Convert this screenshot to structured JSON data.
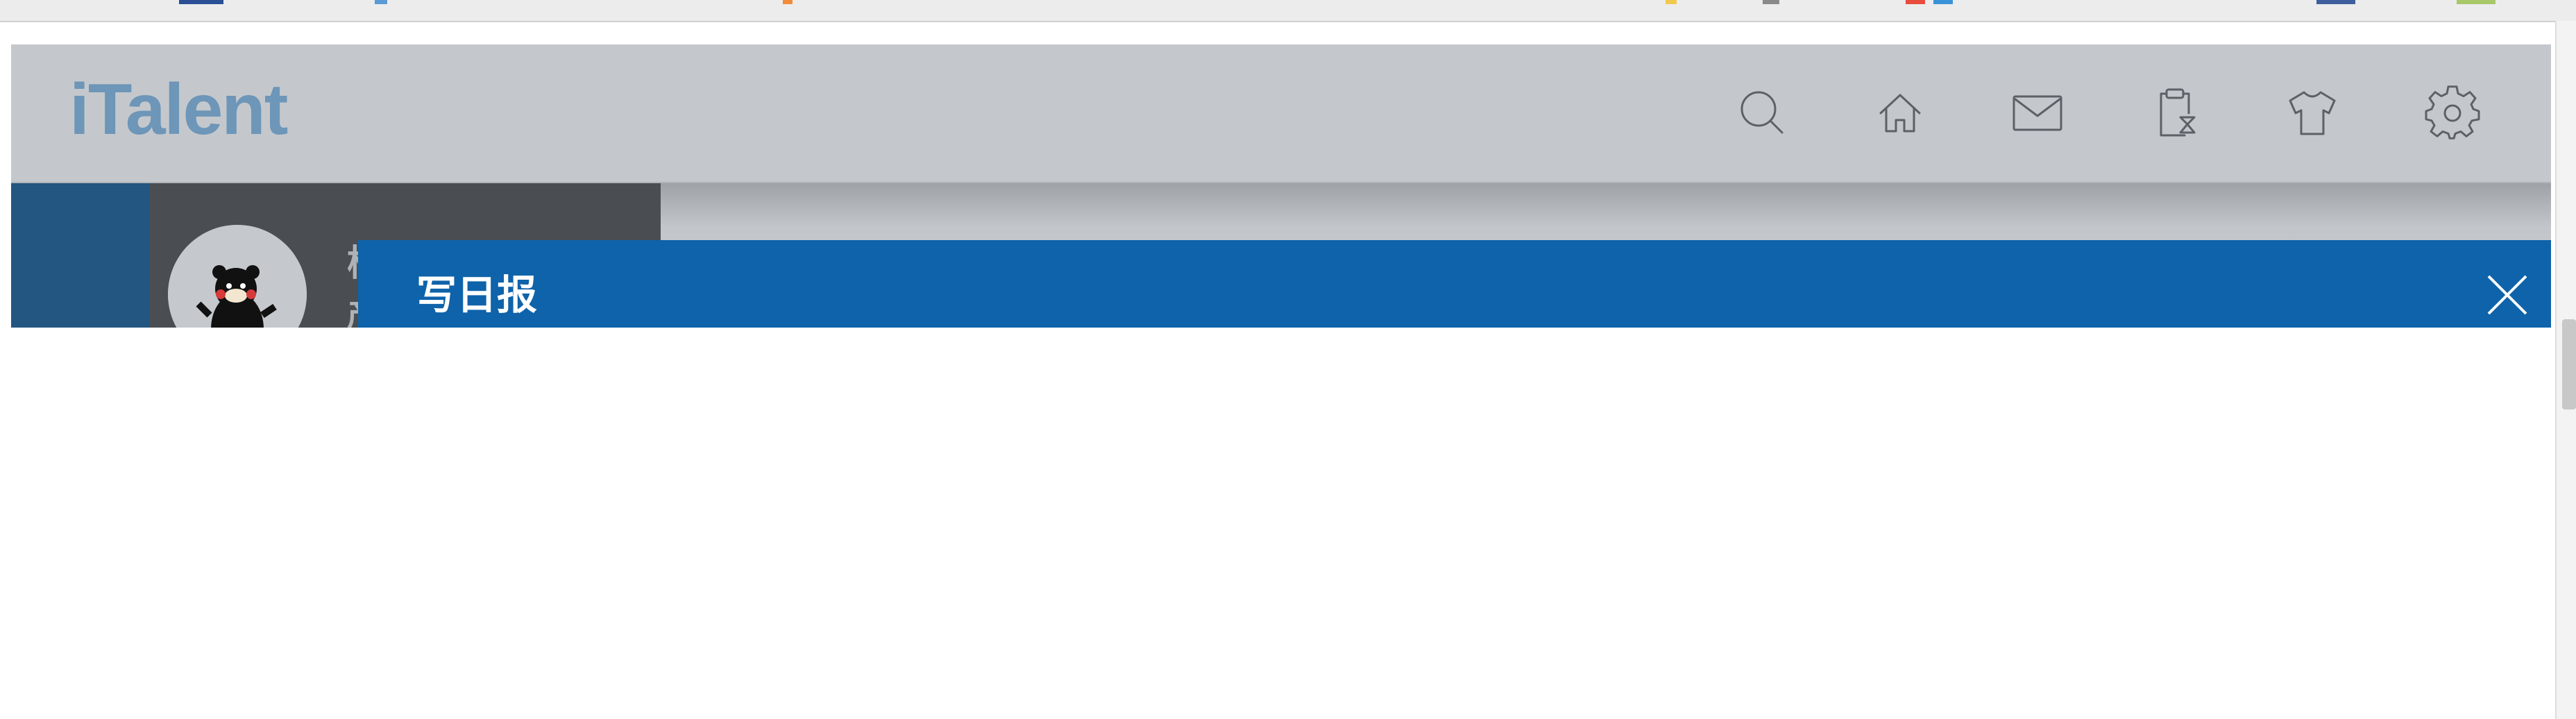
{
  "app": {
    "logo": "iTalent",
    "header_icons": [
      "search-icon",
      "home-icon",
      "mail-icon",
      "clipboard-timer-icon",
      "shirt-icon",
      "gear-icon"
    ]
  },
  "user": {
    "name_partial": "杨",
    "role_partial": "产"
  },
  "modal": {
    "title": "写日报"
  },
  "colors": {
    "header_bg": "#c4c8cc",
    "logo": "#6d96b8",
    "modal_header": "#0e63aa",
    "left_rail": "#235681",
    "user_panel": "#4a4e52"
  }
}
